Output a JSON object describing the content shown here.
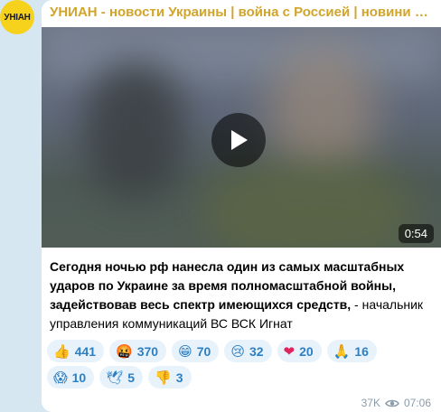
{
  "channel": {
    "avatar_text": "УНІАН",
    "name": "УНИАН - новости Украины | война с Россией | новини України..."
  },
  "video": {
    "duration": "0:54"
  },
  "message": {
    "bold_text": "Сегодня ночью рф нанесла один из самых масштабных ударов по Украине за время полномасштабной войны, задействовав весь спектр имеющихся средств,",
    "plain_text": " - начальник управления коммуникаций ВС ВСК Игнат"
  },
  "reactions": [
    {
      "emoji": "👍",
      "icon": "thumbs-up-icon",
      "count": "441"
    },
    {
      "emoji": "🤬",
      "icon": "cursing-face-icon",
      "count": "370"
    },
    {
      "emoji": "😁",
      "icon": "grin-icon",
      "count": "70"
    },
    {
      "emoji": "😢",
      "icon": "crying-face-icon",
      "count": "32"
    },
    {
      "emoji": "❤",
      "icon": "heart-icon",
      "count": "20"
    },
    {
      "emoji": "🙏",
      "icon": "pray-icon",
      "count": "16"
    },
    {
      "emoji": "😱",
      "icon": "scream-icon",
      "count": "10"
    },
    {
      "emoji": "🕊",
      "icon": "dove-icon",
      "count": "5"
    },
    {
      "emoji": "👎",
      "icon": "thumbs-down-icon",
      "count": "3"
    }
  ],
  "meta": {
    "views": "37K",
    "time": "07:06"
  },
  "colors": {
    "background": "#d6e7f1",
    "channel_name": "#d1a42b",
    "reaction_bg": "#e7f2fb",
    "reaction_text": "#2d7fc2",
    "avatar": "#f7d21c"
  }
}
